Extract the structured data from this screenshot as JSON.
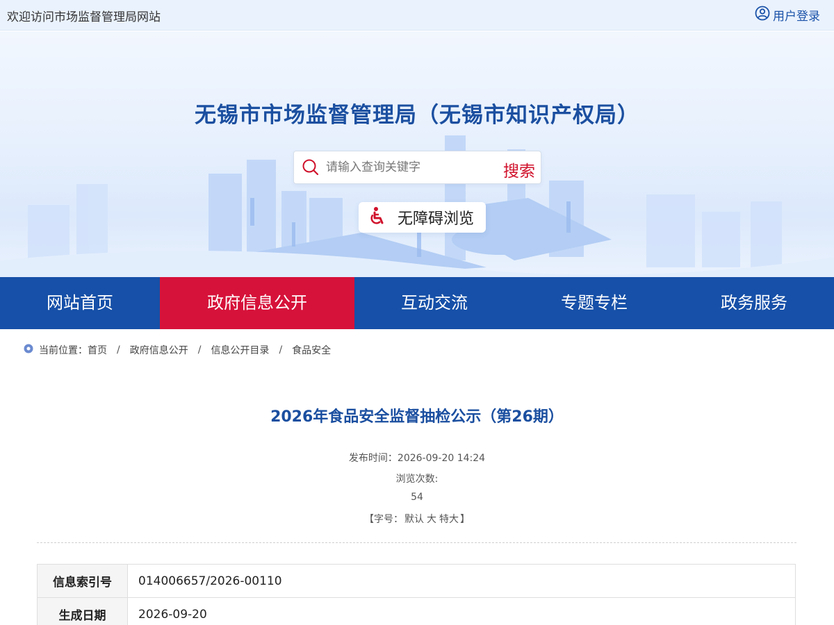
{
  "topbar": {
    "welcome": "欢迎访问市场监督管理局网站",
    "login_label": "用户登录"
  },
  "site": {
    "title": "无锡市市场监督管理局（无锡市知识产权局）"
  },
  "search": {
    "placeholder": "请输入查询关键字",
    "button_label": "搜索"
  },
  "accessibility": {
    "label": "无障碍浏览"
  },
  "nav": {
    "items": [
      "网站首页",
      "政府信息公开",
      "互动交流",
      "专题专栏",
      "政务服务"
    ],
    "active_index": 1
  },
  "breadcrumb": {
    "prefix": "当前位置：",
    "items": [
      "首页",
      "政府信息公开",
      "信息公开目录",
      "食品安全"
    ],
    "separator": "/"
  },
  "article": {
    "title": "2026年食品安全监督抽检公示（第26期）",
    "publish_label": "发布时间：",
    "publish_time": "2026-09-20 14:24",
    "views_label": "浏览次数:",
    "views": "54",
    "fontsize": {
      "open": "【字号：",
      "default": "默认",
      "large": "大",
      "xlarge": "特大",
      "close": "】"
    }
  },
  "info_table": [
    {
      "key": "信息索引号",
      "value": "014006657/2026-00110"
    },
    {
      "key": "生成日期",
      "value": "2026-09-20"
    }
  ],
  "colors": {
    "nav_bg": "#1650a8",
    "nav_active": "#d6123a",
    "title_blue": "#1b4fa0",
    "search_red": "#d0112b"
  },
  "icons": {
    "login": "user-circle-icon",
    "search": "search-icon",
    "accessibility": "wheelchair-icon",
    "location": "location-pin-icon"
  }
}
